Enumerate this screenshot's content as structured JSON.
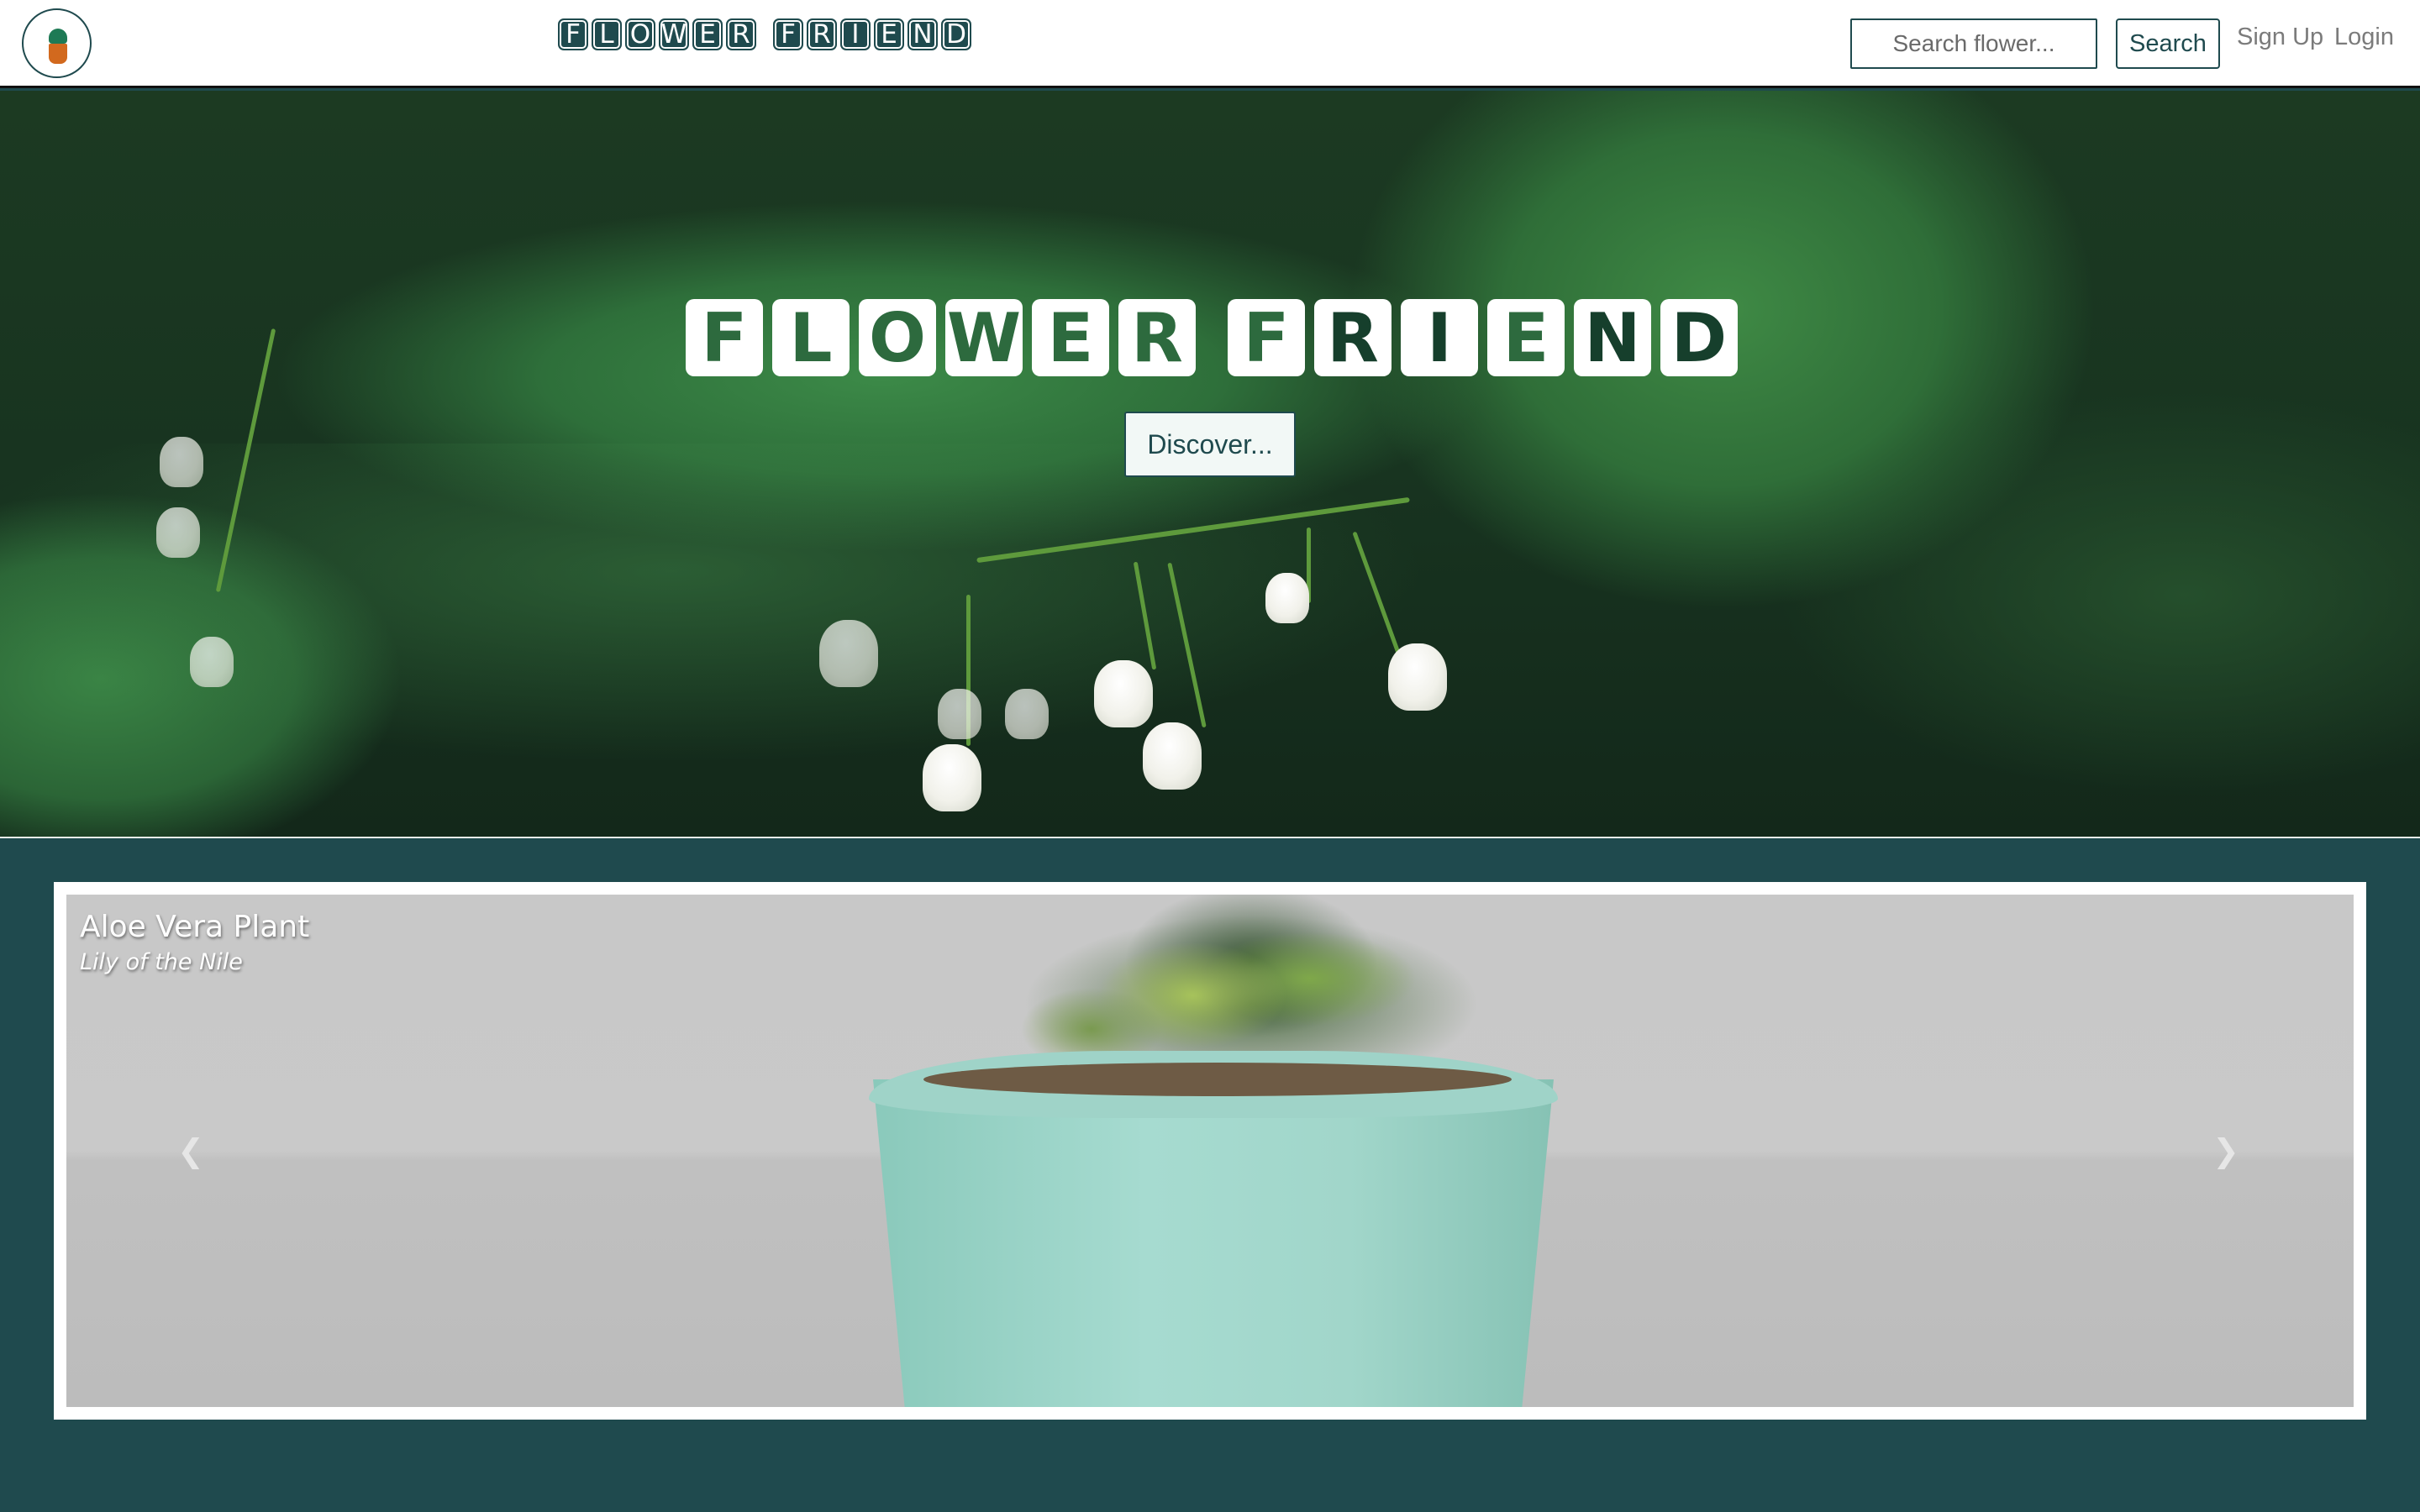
{
  "navbar": {
    "logo": {
      "icon": "potted-plant-icon"
    },
    "title_letters": [
      "F",
      "L",
      "O",
      "W",
      "E",
      "R",
      " ",
      "F",
      "R",
      "I",
      "E",
      "N",
      "D"
    ],
    "search": {
      "placeholder": "Search flower...",
      "button_label": "Search"
    },
    "links": {
      "signup": "Sign Up",
      "login": "Login"
    }
  },
  "hero": {
    "title_letters": [
      "F",
      "L",
      "O",
      "W",
      "E",
      "R",
      " ",
      "F",
      "R",
      "I",
      "E",
      "N",
      "D"
    ],
    "discover_label": "Discover..."
  },
  "carousel": {
    "slide": {
      "title": "Aloe Vera Plant",
      "subtitle": "Lily of the Nile"
    },
    "controls": {
      "prev_icon": "chevron-left-icon",
      "next_icon": "chevron-right-icon"
    }
  },
  "colors": {
    "brand": "#1f4a4e",
    "hero_letter": "#2d6a3e",
    "navbar_bg": "#ffffff"
  }
}
